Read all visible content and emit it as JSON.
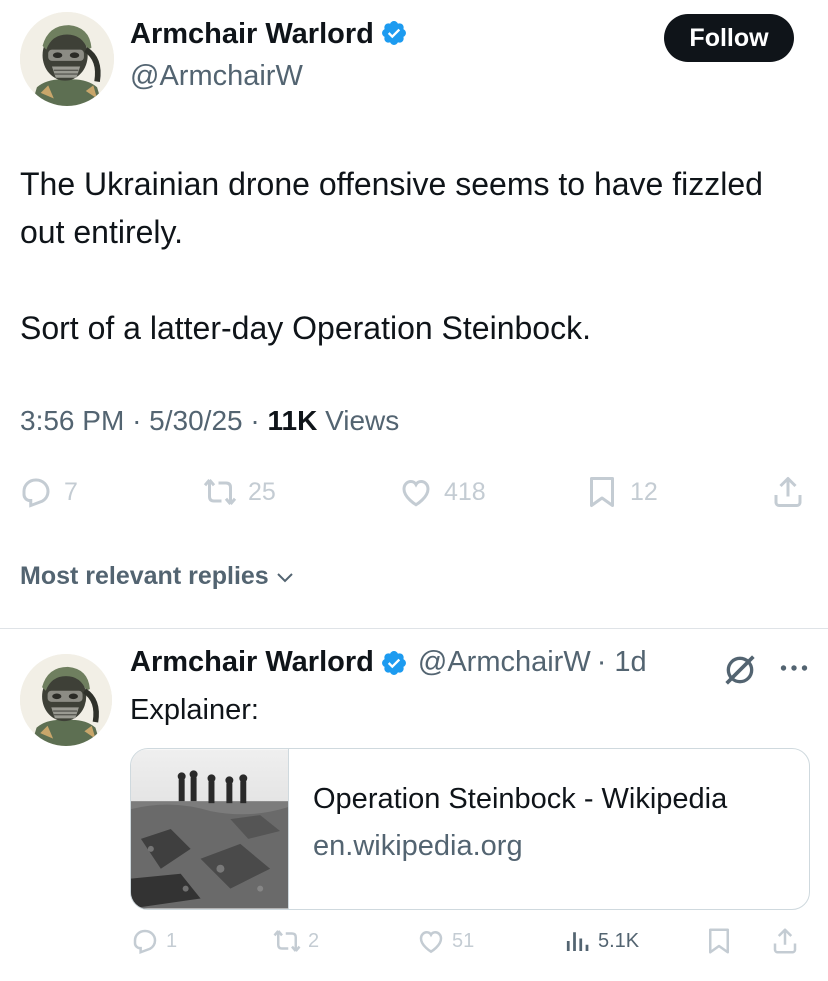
{
  "tweet": {
    "author_name": "Armchair Warlord",
    "author_handle": "@ArmchairW",
    "follow_label": "Follow",
    "paragraphs": [
      "The Ukrainian drone offensive seems to have fizzled out entirely.",
      "Sort of a latter-day Operation Steinbock."
    ],
    "time": "3:56 PM",
    "date": "5/30/25",
    "separator": "·",
    "views_count": "11K",
    "views_label": "Views",
    "actions": {
      "replies": "7",
      "reposts": "25",
      "likes": "418",
      "bookmarks": "12"
    }
  },
  "replies_section": {
    "sort_label": "Most relevant replies"
  },
  "reply": {
    "author_name": "Armchair Warlord",
    "author_handle": "@ArmchairW",
    "age": "· 1d",
    "text": "Explainer:",
    "link_card": {
      "title": "Operation Steinbock - Wikipedia",
      "domain": "en.wikipedia.org"
    },
    "actions": {
      "replies": "1",
      "reposts": "2",
      "likes": "51",
      "views": "5.1K"
    }
  },
  "colors": {
    "text_primary": "#0f1419",
    "text_secondary": "#536471",
    "verified_blue": "#1d9bf0",
    "action_gray": "#c4ccd3",
    "border": "#cfd9de"
  },
  "icons": [
    "verified-badge-icon",
    "reply-icon",
    "repost-icon",
    "like-icon",
    "bookmark-icon",
    "share-icon",
    "chevron-down-icon",
    "grok-icon",
    "more-icon",
    "views-icon"
  ]
}
